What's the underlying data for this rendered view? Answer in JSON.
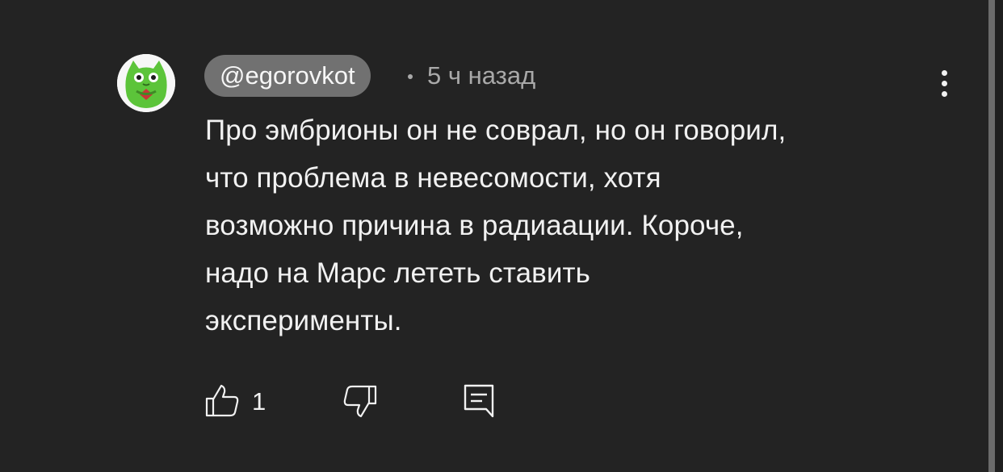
{
  "comment": {
    "author": "@egorovkot",
    "timestamp": "5 ч назад",
    "text_lines": [
      "Про эмбрионы он не соврал, но он говорил,",
      "что проблема в невесомости, хотя",
      "возможно причина в радиаации. Короче,",
      "надо на Марс лететь ставить",
      "эксперименты."
    ],
    "like_count": "1"
  },
  "icons": {
    "avatar": "green-cat-avatar",
    "menu": "more-vertical-icon",
    "like": "thumb-up-icon",
    "dislike": "thumb-down-icon",
    "reply": "comment-reply-icon"
  },
  "colors": {
    "background": "#232323",
    "author_chip": "#717171",
    "muted_text": "#a9a9a9",
    "avatar_green": "#5cc43a"
  }
}
